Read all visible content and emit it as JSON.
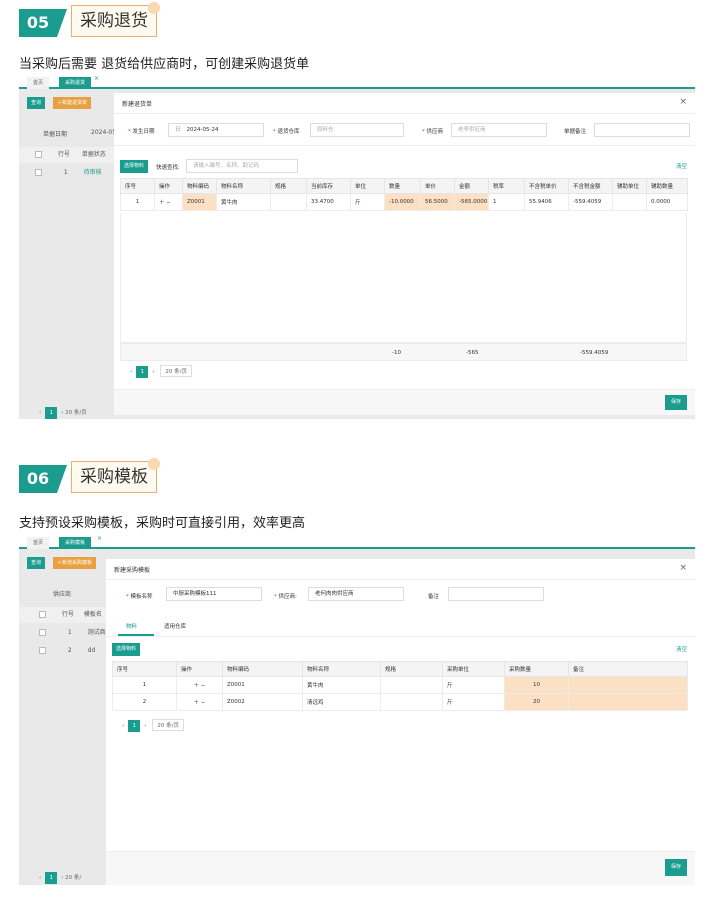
{
  "section1": {
    "number": "05",
    "title": "采购退货",
    "description": "当采购后需要 退货给供应商时，可创建采购退货单",
    "tabs": [
      "首页",
      "采购退货"
    ],
    "bg_buttons": {
      "query": "查询",
      "new": "＋新建退货单"
    },
    "bg_date_label": "单据日期",
    "bg_date_value": "2024-05",
    "bg_headers": [
      "行号",
      "单据状态"
    ],
    "bg_row": {
      "no": "1",
      "status": "待审核"
    },
    "bg_pager": {
      "page": "1",
      "size": "20 条/页"
    },
    "modal": {
      "title": "新建退货单",
      "close": "×",
      "fields": {
        "date_label": "发生日期",
        "date_value": "2024-05-24",
        "date_prefix": "日",
        "warehouse_label": "退货仓库",
        "warehouse_placeholder": "原料仓",
        "supplier_label": "供应商",
        "supplier_placeholder": "老李供应商",
        "note_label": "单据备注"
      },
      "select_button": "选择物料",
      "quick_search_label": "快速查找:",
      "quick_search_placeholder": "请输入编号、名称、助记码",
      "clear": "清空",
      "columns": [
        "序号",
        "操作",
        "物料编码",
        "物料名称",
        "规格",
        "当前库存",
        "单位",
        "数量",
        "单价",
        "金额",
        "税率",
        "不含税单价",
        "不含税金额",
        "辅助单位",
        "辅助数量"
      ],
      "rows": [
        {
          "seq": "1",
          "ops": "＋ −",
          "code": "Z0001",
          "name": "黄牛肉",
          "spec": "",
          "stock": "33.4700",
          "unit": "斤",
          "qty": "-10.0000",
          "price": "56.5000",
          "amount": "-565.0000",
          "tax": "1",
          "ex_price": "55.9406",
          "ex_amount": "-559.4059",
          "aux_unit": "",
          "aux_qty": "0.0000"
        }
      ],
      "totals": {
        "qty": "-10",
        "amount": "-565",
        "ex_amount": "-559.4059"
      },
      "pager": {
        "page": "1",
        "size": "20 条/页"
      },
      "save": "保存"
    }
  },
  "section2": {
    "number": "06",
    "title": "采购模板",
    "description": "支持预设采购模板，采购时可直接引用，效率更高",
    "tabs": [
      "首页",
      "采购模板"
    ],
    "bg_buttons": {
      "query": "查询",
      "new": "＋新增采购模板"
    },
    "bg_supplier_label": "供应商",
    "bg_headers": [
      "行号",
      "模板名"
    ],
    "bg_rows": [
      {
        "no": "1",
        "name": "测试商"
      },
      {
        "no": "2",
        "name": "dd"
      }
    ],
    "bg_pager": {
      "page": "1",
      "size": "20 条/"
    },
    "modal": {
      "title": "新建采购模板",
      "close": "×",
      "fields": {
        "name_label": "模板名称",
        "name_value": "中厨采购模板111",
        "supplier_label": "供应商:",
        "supplier_value": "老何肉肉供应商",
        "note_label": "备注"
      },
      "subtabs": [
        "物料",
        "适用仓库"
      ],
      "select_button": "选择物料",
      "clear": "清空",
      "columns": [
        "序号",
        "操作",
        "物料编码",
        "物料名称",
        "规格",
        "采购单位",
        "采购数量",
        "备注"
      ],
      "rows": [
        {
          "seq": "1",
          "ops": "＋ −",
          "code": "Z0001",
          "name": "黄牛肉",
          "spec": "",
          "unit": "斤",
          "qty": "10",
          "note": ""
        },
        {
          "seq": "2",
          "ops": "＋ −",
          "code": "Z0002",
          "name": "清远鸡",
          "spec": "",
          "unit": "斤",
          "qty": "20",
          "note": ""
        }
      ],
      "pager": {
        "page": "1",
        "size": "20 条/页"
      },
      "save": "保存"
    }
  },
  "colors": {
    "accent": "#1a9c8e",
    "highlight": "#fce0c4",
    "orange_button": "#e8a040"
  }
}
